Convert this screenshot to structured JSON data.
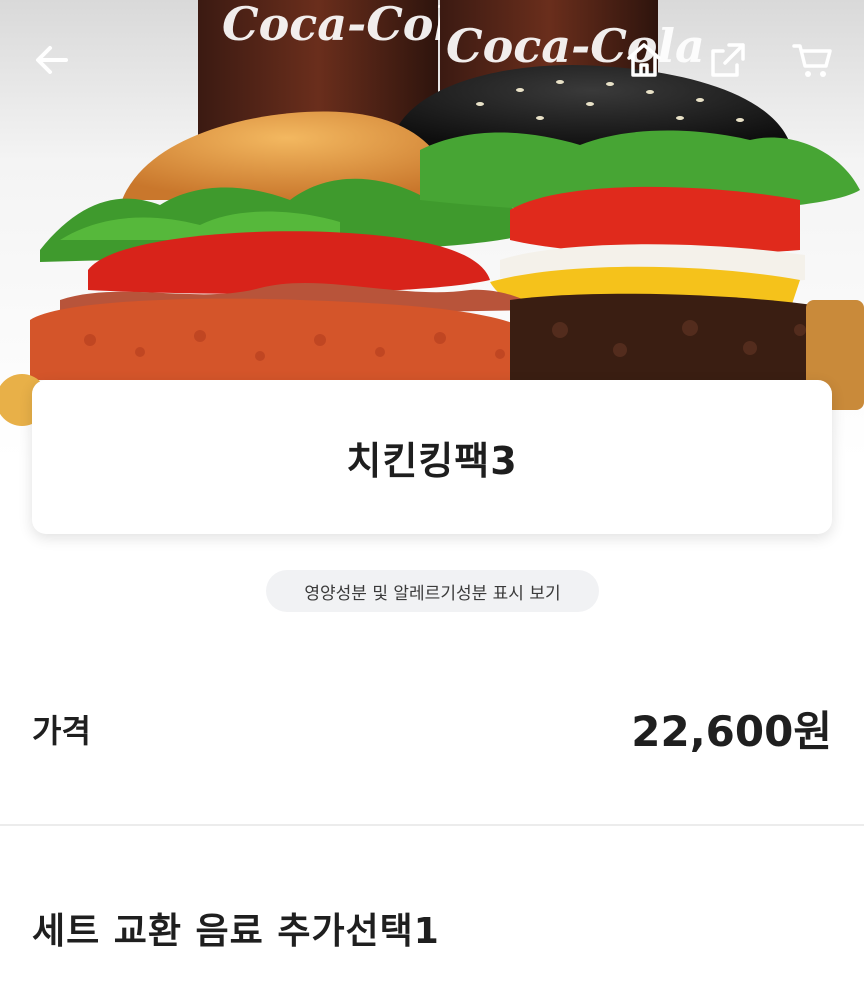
{
  "hero": {
    "can_text_left": "Coca-Cola",
    "can_text_right": "Coca-Cola"
  },
  "topbar": {
    "back_icon": "arrow-left-icon",
    "home_icon": "home-icon",
    "share_icon": "share-icon",
    "cart_icon": "cart-icon"
  },
  "product": {
    "name": "치킨킹팩3",
    "nutrition_link": "영양성분 및 알레르기성분 표시 보기"
  },
  "price": {
    "label": "가격",
    "value": "22,600원"
  },
  "options": {
    "section_title": "세트 교환 음료 추가선택1"
  },
  "colors": {
    "text": "#1f1f1f",
    "chip_bg": "#f1f2f4",
    "divider": "#ececec",
    "card_bg": "#ffffff"
  }
}
